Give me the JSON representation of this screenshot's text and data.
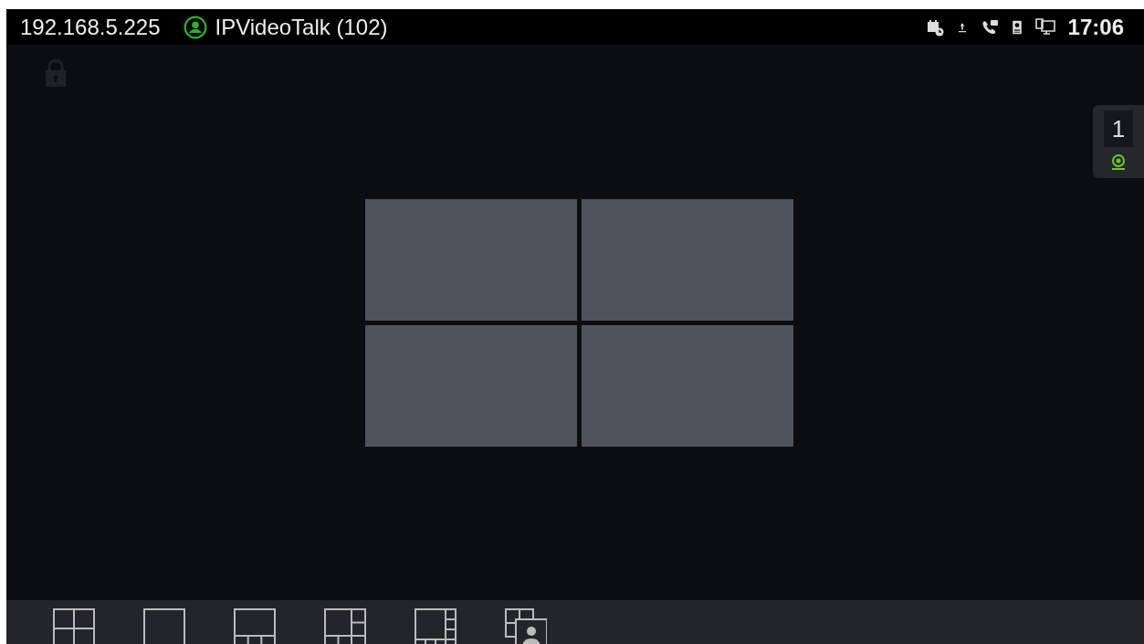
{
  "status_bar": {
    "ip": "192.168.5.225",
    "account": "IPVideoTalk (102)",
    "time": "17:06"
  },
  "side_panel": {
    "count": "1"
  },
  "video_grid": {
    "tiles": [
      {
        "kind": "empty"
      },
      {
        "kind": "empty"
      },
      {
        "kind": "empty"
      },
      {
        "kind": "empty"
      }
    ]
  },
  "layout_bar": [
    {
      "kind": "quad"
    },
    {
      "kind": "single"
    },
    {
      "kind": "one-plus-three"
    },
    {
      "kind": "one-plus-five"
    },
    {
      "kind": "one-plus-seven"
    },
    {
      "kind": "pip"
    }
  ]
}
